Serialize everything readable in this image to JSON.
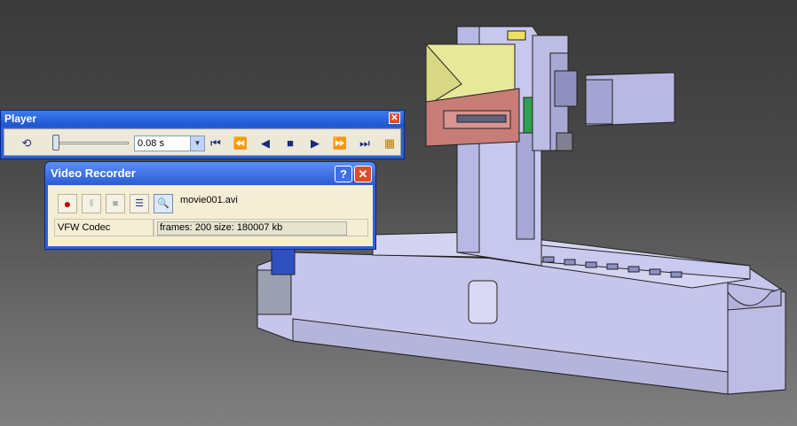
{
  "player": {
    "title": "Player",
    "close_glyph": "✕",
    "step_value": "0.08 s",
    "buttons": [
      {
        "name": "loop-icon",
        "glyph": "⟲"
      },
      {
        "name": "first-frame-icon",
        "glyph": "⏮"
      },
      {
        "name": "step-back-icon",
        "glyph": "⏪"
      },
      {
        "name": "play-backward-icon",
        "glyph": "◀"
      },
      {
        "name": "stop-icon",
        "glyph": "■"
      },
      {
        "name": "play-icon",
        "glyph": "▶"
      },
      {
        "name": "step-forward-icon",
        "glyph": "⏩"
      },
      {
        "name": "last-frame-icon",
        "glyph": "⏭"
      },
      {
        "name": "player-settings-icon",
        "glyph": "▦"
      }
    ],
    "slider_fraction": 0.0
  },
  "recorder": {
    "title": "Video Recorder",
    "help_glyph": "?",
    "close_glyph": "✕",
    "file_name": "movie001.avi",
    "codec": "VFW Codec",
    "status": "frames: 200  size: 180007   kb",
    "buttons": [
      {
        "name": "record-icon",
        "glyph": "●"
      },
      {
        "name": "pause-icon",
        "glyph": "‖"
      },
      {
        "name": "stop-icon",
        "glyph": "■"
      },
      {
        "name": "properties-icon",
        "glyph": "☰"
      },
      {
        "name": "preview-icon",
        "glyph": "🔍"
      }
    ]
  },
  "colors": {
    "titlebar_blue": "#2b5fd6",
    "panel_face": "#ece9d8",
    "recorder_face": "#f6eed4",
    "machine_body": "#c8c8ec",
    "machine_yellow": "#e8e89a",
    "machine_red": "#c87c78"
  }
}
